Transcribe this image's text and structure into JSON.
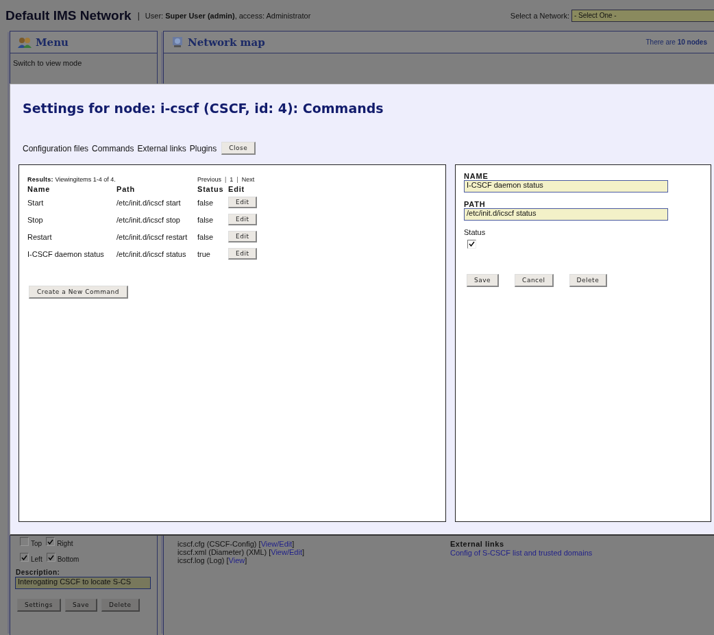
{
  "header": {
    "title": "Default IMS Network",
    "separator": "|",
    "user_info": "User: **Super User (admin)**, access: Administrator",
    "network_select": {
      "label": "Select a Network:",
      "value": "- Select One -"
    }
  },
  "menu_panel": {
    "title": "Menu",
    "items": [
      "Switch to view mode"
    ]
  },
  "map_panel": {
    "title": "Network map",
    "node_count": "There are **10 nodes**"
  },
  "node_editor": {
    "sides": [
      [
        {
          "label": "Top",
          "checked": false
        },
        {
          "label": "Right",
          "checked": true
        }
      ],
      [
        {
          "label": "Left",
          "checked": true
        },
        {
          "label": "Bottom",
          "checked": true
        }
      ]
    ],
    "description_label": "Description:",
    "description_value": "Interogating CSCF to locate S-CS",
    "buttons": [
      "Settings",
      "Save",
      "Delete"
    ]
  },
  "files": [
    {
      "text": "icscf.cfg (CSCF-Config) [",
      "link": "View/Edit",
      "after": "]"
    },
    {
      "text": "icscf.xml (Diameter) (XML) [",
      "link": "View/Edit",
      "after": "]"
    },
    {
      "text": "icscf.log (Log) [",
      "link": "View",
      "after": "]"
    }
  ],
  "external_links": {
    "title": "External links",
    "links": [
      "Config of S-CSCF list and trusted domains"
    ]
  },
  "modal": {
    "title": "Settings for node: i-cscf (CSCF, id: 4): Commands",
    "tabs": [
      "Configuration files",
      "Commands",
      "External links",
      "Plugins"
    ],
    "close_button": "Close",
    "results": {
      "summary": "**Results:** Viewingitems 1-4 of 4.",
      "pager": [
        {
          "kind": "link",
          "text": "Previous"
        },
        {
          "kind": "sep",
          "text": "|"
        },
        {
          "kind": "link",
          "text": "1"
        },
        {
          "kind": "sep",
          "text": "|"
        },
        {
          "kind": "link",
          "text": "Next"
        }
      ]
    },
    "table": {
      "columns": [
        "Name",
        "Path",
        "Status",
        "Edit"
      ],
      "rows": [
        {
          "name": "Start",
          "path": "/etc/init.d/icscf start",
          "status": "false",
          "button": "Edit"
        },
        {
          "name": "Stop",
          "path": "/etc/init.d/icscf stop",
          "status": "false",
          "button": "Edit"
        },
        {
          "name": "Restart",
          "path": "/etc/init.d/icscf restart",
          "status": "false",
          "button": "Edit"
        },
        {
          "name": "I-CSCF daemon status",
          "path": "/etc/init.d/icscf status",
          "status": "true",
          "button": "Edit"
        }
      ]
    },
    "create_button": "Create a New Command",
    "form": {
      "fields": [
        {
          "label": "NAME",
          "value": "I-CSCF daemon status"
        },
        {
          "label": "PATH",
          "value": "/etc/init.d/icscf status"
        }
      ],
      "status_label": "Status",
      "status_checked": true,
      "buttons": [
        "Save",
        "Cancel",
        "Delete"
      ]
    }
  }
}
